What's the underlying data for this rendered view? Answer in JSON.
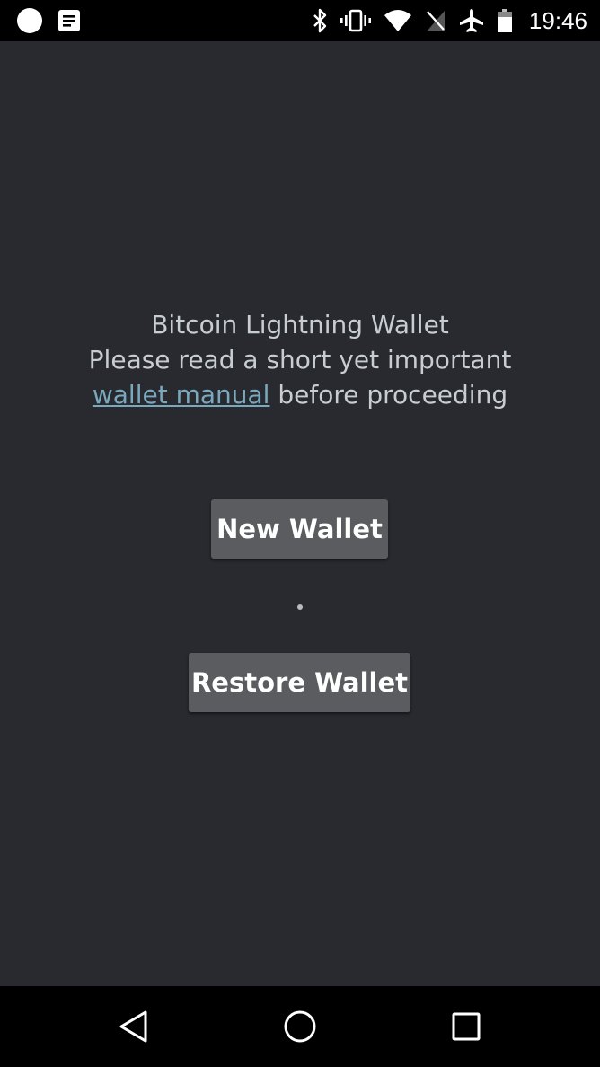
{
  "status_bar": {
    "time": "19:46",
    "left_icons": [
      "circle-notification-icon",
      "document-notification-icon"
    ],
    "right_icons": [
      "bluetooth-icon",
      "vibrate-icon",
      "wifi-icon",
      "no-sim-icon",
      "airplane-mode-icon",
      "battery-icon"
    ]
  },
  "intro": {
    "line1": "Bitcoin Lightning Wallet",
    "line2": "Please read a short yet important",
    "link_text": "wallet manual",
    "line3_rest": " before proceeding"
  },
  "buttons": {
    "new_wallet": "New Wallet",
    "restore_wallet": "Restore Wallet"
  },
  "nav_bar": {
    "icons": [
      "back-icon",
      "home-icon",
      "recents-icon"
    ]
  },
  "colors": {
    "background": "#282a2f",
    "text": "#c8cdd1",
    "link": "#7aa9bd",
    "button": "#5a5c5f"
  }
}
